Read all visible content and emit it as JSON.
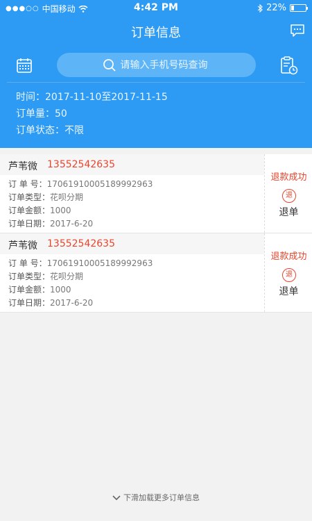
{
  "status_bar": {
    "carrier": "中国移动",
    "time": "4:42 PM",
    "battery": "22%",
    "battery_level": 0.22
  },
  "header": {
    "title": "订单信息",
    "search_placeholder": "请输入手机号码查询",
    "info": {
      "time_label": "时间：",
      "time_value": "2017-11-10至2017-11-15",
      "count_label": "订单量：",
      "count_value": "50",
      "status_label": "订单状态：",
      "status_value": "不限"
    }
  },
  "orders": [
    {
      "name": "芦苇微",
      "phone": "13552542635",
      "order_no_label": "订 单 号：",
      "order_no": "17061910005189992963",
      "type_label": "订单类型：",
      "type": "花呗分期",
      "amount_label": "订单金额：",
      "amount": "1000",
      "date_label": "订单日期：",
      "date": "2017-6-20",
      "status": "退款成功",
      "icon_char": "退",
      "action": "退单"
    },
    {
      "name": "芦苇微",
      "phone": "13552542635",
      "order_no_label": "订 单 号：",
      "order_no": "17061910005189992963",
      "type_label": "订单类型：",
      "type": "花呗分期",
      "amount_label": "订单金额：",
      "amount": "1000",
      "date_label": "订单日期：",
      "date": "2017-6-20",
      "status": "退款成功",
      "icon_char": "退",
      "action": "退单"
    }
  ],
  "footer": {
    "load_more": "下滑加载更多订单信息"
  },
  "colors": {
    "primary": "#2d9af3",
    "accent": "#e8452c"
  }
}
